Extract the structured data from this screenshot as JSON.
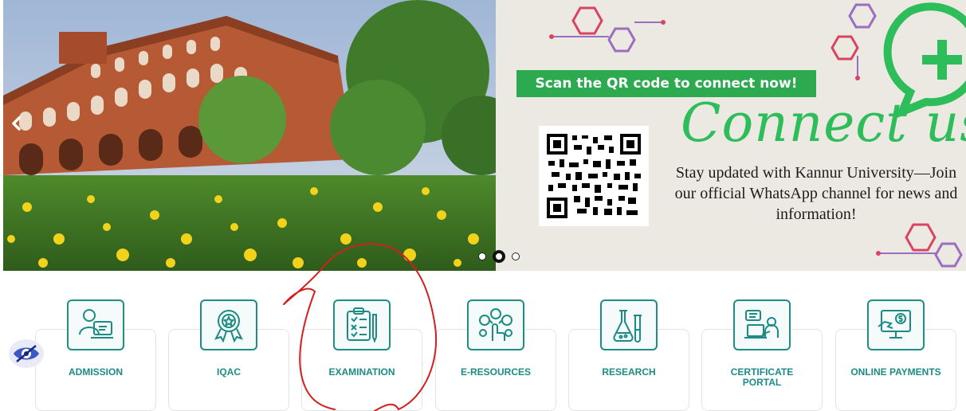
{
  "slider": {
    "promo": {
      "banner_text": "Scan the QR code to connect now!",
      "title": "Connect us",
      "description": "Stay updated with Kannur University—Join our official WhatsApp channel for news and information!"
    },
    "controls": {
      "prev_icon": "chevron-left-icon",
      "dots": [
        "slide-1",
        "slide-2",
        "slide-3"
      ],
      "active_dot": 2
    }
  },
  "quick_links": [
    {
      "label": "ADMISSION",
      "icon": "admission-icon"
    },
    {
      "label": "IQAC",
      "icon": "award-badge-icon"
    },
    {
      "label": "EXAMINATION",
      "icon": "exam-clipboard-icon"
    },
    {
      "label": "E-RESOURCES",
      "icon": "e-resources-icon"
    },
    {
      "label": "RESEARCH",
      "icon": "lab-flask-icon"
    },
    {
      "label": "CERTIFICATE PORTAL",
      "icon": "certificate-portal-icon"
    },
    {
      "label": "ONLINE PAYMENTS",
      "icon": "online-payment-icon"
    }
  ],
  "accessibility": {
    "icon": "eye-icon"
  },
  "colors": {
    "brand_teal": "#1c8b86",
    "whatsapp_green": "#2dbd5a",
    "annotation_red": "#d21f1f"
  }
}
